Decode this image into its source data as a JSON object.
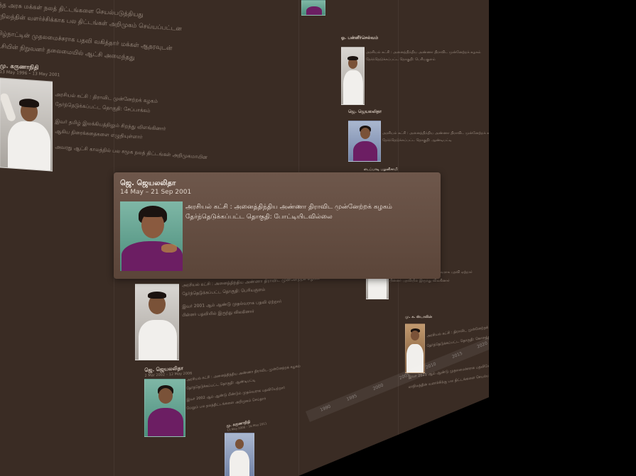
{
  "popup": {
    "name": "ஜெ. ஜெயலலிதா",
    "dates": "14 May – 21 Sep 2001",
    "party_line": "அரசியல் கட்சி : அனைத்திந்திய அண்ணா திராவிட முன்னேற்றக் கழகம்",
    "constituency_line": "தேர்ந்தெடுக்கப்பட்ட தொகுதி: போட்டியிடவில்லை",
    "photo_icon": "portrait-photo"
  },
  "background_text": {
    "top_lines": [
      "இந்த அரசு மக்கள் நலத் திட்டங்களை செயல்படுத்தியது",
      "மாநிலத்தின் வளர்ச்சிக்காக பல திட்டங்கள் அறிமுகம் செய்யப்பட்டன",
      "தமிழ்நாட்டின் முதலமைச்சராக பதவி வகித்தார் மக்கள் ஆதரவுடன்",
      "கட்சியின் நிறுவனர் தலைமையில் ஆட்சி அமைந்தது"
    ],
    "block_a_name": "மு. கருணாநிதி",
    "block_a_dates": "13 May 1996 – 13 May 2001",
    "block_a_lines": [
      "அரசியல் கட்சி : திராவிட முன்னேற்றக் கழகம்",
      "தேர்ந்தெடுக்கப்பட்ட தொகுதி: சேப்பாக்கம்",
      "இவர் தமிழ் இலக்கியத்திலும் சிறந்து விளங்கினார்",
      "ஆகிய திரைக்கதைகளை எழுதியுள்ளார்",
      "அவரது ஆட்சி காலத்தில் பல சமூக நலத் திட்டங்கள் அறிமுகமாயின"
    ],
    "right_col_names": [
      "ஓ. பன்னீர்செல்வம்",
      "ஜெ. ஜெயலலிதா",
      "எடப்பாடி பழனிசாமி",
      "மு. க. ஸ்டாலின்"
    ],
    "lower_block_lines": [
      "அரசியல் கட்சி : அனைத்திந்திய அண்ணா திராவிட முன்னேற்றக் கழகம்",
      "தேர்ந்தெடுக்கப்பட்ட தொகுதி: பெரியகுளம்",
      "இவர் 2001 ஆம் ஆண்டு முதல்வராக பதவி ஏற்றார்",
      "பின்னர் பதவியில் இருந்து விலகினார்"
    ],
    "lower2_name": "ஜெ. ஜெயலலிதா",
    "lower2_dates": "2 Mar 2002 – 12 May 2006",
    "lower2_lines": [
      "அரசியல் கட்சி : அனைத்திந்திய அண்ணா திராவிட முன்னேற்றக் கழகம்",
      "தேர்ந்தெடுக்கப்பட்ட தொகுதி: ஆண்டிபட்டி",
      "இவர் 2002 ஆம் ஆண்டு மீண்டும் முதல்வராக பதவியேற்றார்",
      "மேலும் பல நலத்திட்டங்களை அறிமுகம் செய்தார்"
    ],
    "lower3_name": "மு. கருணாநிதி",
    "lower3_dates": "13 May 2006 – 16 May 2011",
    "stalin_lines": [
      "அரசியல் கட்சி : திராவிட முன்னேற்றக் கழகம்",
      "தேர்ந்தெடுக்கப்பட்ட தொகுதி: கொளத்தூர்",
      "இவர் 2021 ஆம் ஆண்டு முதலமைச்சராக பதவியேற்றார்",
      "மாநிலத்தின் வளர்ச்சிக்கு பல திட்டங்களை செயல்படுத்தி வருகிறார்"
    ]
  },
  "axis_ticks": [
    "1990",
    "1995",
    "2000",
    "2005",
    "2010",
    "2015",
    "2020"
  ]
}
